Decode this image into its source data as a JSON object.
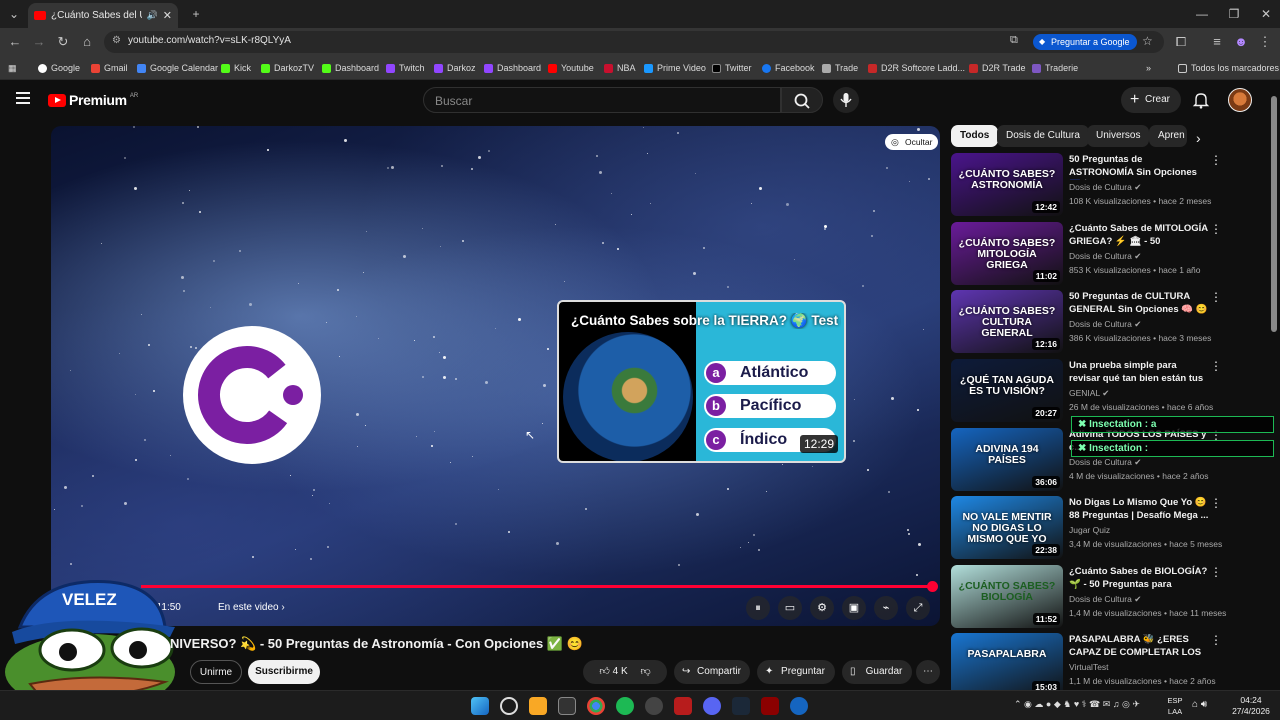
{
  "browser": {
    "tab_title": "¿Cuánto Sabes del UNIVERSO?",
    "url": "youtube.com/watch?v=sLK-r8QLYyA",
    "ask_google": "Preguntar a Google",
    "all_bookmarks": "Todos los marcadores",
    "bookmarks": [
      "Google",
      "Gmail",
      "Google Calendar",
      "Kick",
      "DarkozTV",
      "Dashboard",
      "Twitch",
      "Darkoz",
      "Dashboard",
      "Youtube",
      "NBA",
      "Prime Video",
      "Twitter",
      "Facebook",
      "Trade",
      "D2R Softcore Ladd...",
      "D2R Trade",
      "Traderie"
    ]
  },
  "yt": {
    "logo": "Premium",
    "logo_country": "AR",
    "search_placeholder": "Buscar",
    "create": "Crear"
  },
  "player": {
    "hide": "Ocultar",
    "time": "/ 11:50",
    "chapter": "En este video",
    "progress": 1.0,
    "endcard": {
      "title": "¿Cuánto Sabes sobre la TIERRA? 🌍 Test de Conocimientos - Edición Planet...",
      "options": [
        {
          "letter": "a",
          "text": "Atlántico"
        },
        {
          "letter": "b",
          "text": "Pacífico"
        },
        {
          "letter": "c",
          "text": "Índico"
        }
      ],
      "duration": "12:29"
    }
  },
  "video": {
    "title": "NIVERSO? 💫 - 50 Preguntas de Astronomía - Con Opciones ✅ 😊",
    "join": "Unirme",
    "subscribe": "Suscribirme",
    "likes": "4 K",
    "share": "Compartir",
    "ask": "Preguntar",
    "save": "Guardar"
  },
  "pepe_cap": "VELEZ",
  "chips": [
    "Todos",
    "Dosis de Cultura",
    "Universos",
    "Apren"
  ],
  "sidebar": [
    {
      "cap": "¿CUÁNTO SABES? ASTRONOMÍA",
      "dur": "12:42",
      "title": "50 Preguntas de ASTRONOMÍA Sin Opciones 🌌 🔭 😊 - ...",
      "chan": "Dosis de Cultura ✔",
      "meta": "108 K visualizaciones • hace 2 meses",
      "bg": "#4a148c"
    },
    {
      "cap": "¿CUÁNTO SABES? MITOLOGÍA GRIEGA",
      "dur": "11:02",
      "title": "¿Cuánto Sabes de MITOLOGÍA GRIEGA? ⚡ 🏛 - 50 Pregunta...",
      "chan": "Dosis de Cultura ✔",
      "meta": "853 K visualizaciones • hace 1 año",
      "bg": "#6a1b9a"
    },
    {
      "cap": "¿CUÁNTO SABES? CULTURA GENERAL",
      "dur": "12:16",
      "title": "50 Preguntas de CULTURA GENERAL Sin Opciones 🧠 😊 ...",
      "chan": "Dosis de Cultura ✔",
      "meta": "386 K visualizaciones • hace 3 meses",
      "bg": "#5e35b1"
    },
    {
      "cap": "¿QUÉ TAN AGUDA ES TU VISIÓN?",
      "dur": "20:27",
      "title": "Una prueba simple para revisar qué tan bien están tus ojos",
      "chan": "GENIAL ✔",
      "meta": "26 M de visualizaciones • hace 6 años",
      "bg": "#0d1b3a"
    },
    {
      "cap": "ADIVINA 194 PAÍSES",
      "dur": "36:06",
      "title": "Adivina TODOS LOS PAÍSES y c...",
      "chan": "Dosis de Cultura ✔",
      "meta": "4 M de visualizaciones • hace 2 años",
      "bg": "#1565c0"
    },
    {
      "cap": "NO VALE MENTIR NO DIGAS LO MISMO QUE YO",
      "dur": "22:38",
      "title": "No Digas Lo Mismo Que Yo 😊 88 Preguntas | Desafío Mega ...",
      "chan": "Jugar Quiz",
      "meta": "3,4 M de visualizaciones • hace 5 meses",
      "bg": "#1e88e5"
    },
    {
      "cap": "¿CUÁNTO SABES? BIOLOGÍA",
      "dur": "11:52",
      "title": "¿Cuánto Sabes de BIOLOGÍA? 🌱 - 50 Preguntas para Mente...",
      "chan": "Dosis de Cultura ✔",
      "meta": "1,4 M de visualizaciones • hace 11 meses",
      "bg": "#b2dfdb"
    },
    {
      "cap": "PASAPALABRA",
      "dur": "15:03",
      "title": "PASAPALABRA 🐝 ¿ERES CAPAZ DE COMPLETAR LOS 2...",
      "chan": "VirtualTest",
      "meta": "1,1 M de visualizaciones • hace 2 años",
      "bg": "#1976d2"
    }
  ],
  "overlay_tags": [
    "Insectation : a",
    "Insectation :"
  ],
  "taskbar": {
    "lang1": "ESP",
    "lang2": "LAA",
    "time": "04:24",
    "date": "27/4/2026"
  }
}
